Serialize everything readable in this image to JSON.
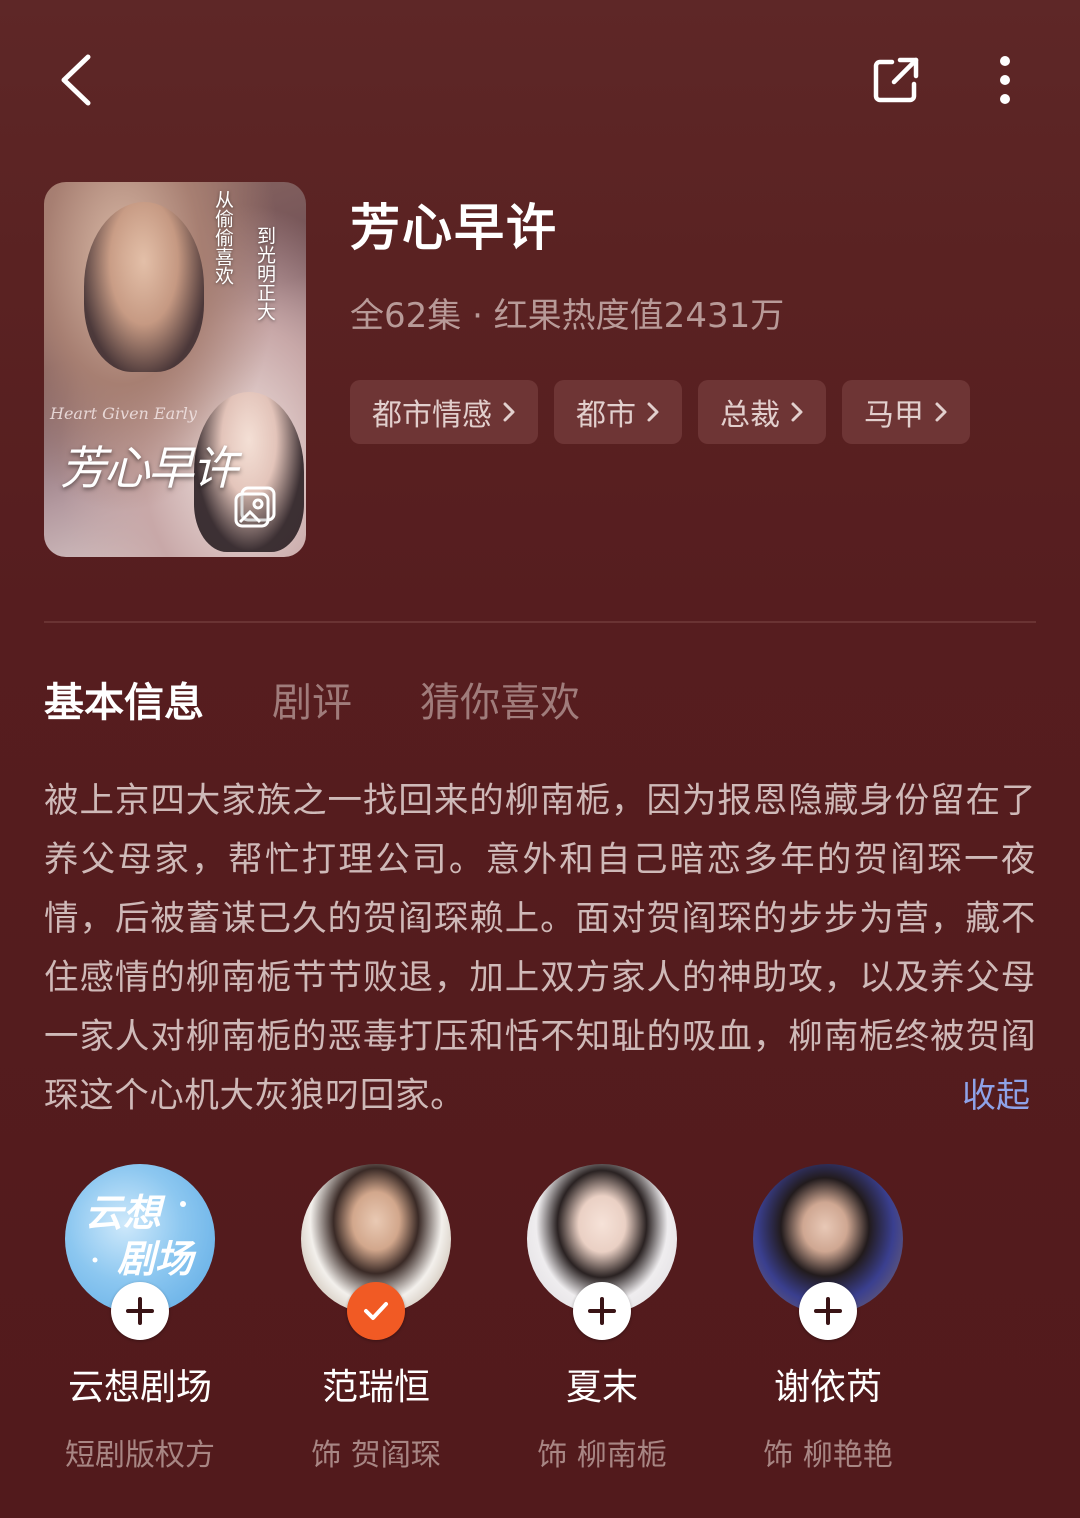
{
  "header": {
    "back_icon": "chevron-left-icon",
    "share_icon": "share-external-icon",
    "more_icon": "more-vertical-icon"
  },
  "poster": {
    "title_art": "芳心早许",
    "en_art": "Heart Given Early",
    "tagline_1": "从偷偷喜欢",
    "tagline_2": "到光明正大"
  },
  "drama": {
    "title": "芳心早许",
    "meta": "全62集 · 红果热度值2431万",
    "tags": [
      {
        "label": "都市情感"
      },
      {
        "label": "都市"
      },
      {
        "label": "总裁"
      },
      {
        "label": "马甲"
      }
    ]
  },
  "tabs": [
    {
      "label": "基本信息",
      "active": true
    },
    {
      "label": "剧评",
      "active": false
    },
    {
      "label": "猜你喜欢",
      "active": false
    }
  ],
  "synopsis": {
    "text": "被上京四大家族之一找回来的柳南栀，因为报恩隐藏身份留在了养父母家，帮忙打理公司。意外和自己暗恋多年的贺阎琛一夜情，后被蓄谋已久的贺阎琛赖上。面对贺阎琛的步步为营，藏不住感情的柳南栀节节败退，加上双方家人的神助攻，以及养父母一家人对柳南栀的恶毒打压和恬不知耻的吸血，柳南栀终被贺阎琛这个心机大灰狼叼回家。",
    "collapse_label": "收起"
  },
  "cast": [
    {
      "name": "云想剧场",
      "role": "短剧版权方",
      "followed": false,
      "logo_line1": "云想",
      "logo_line2": "剧场"
    },
    {
      "name": "范瑞恒",
      "role": "饰 贺阎琛",
      "followed": true
    },
    {
      "name": "夏末",
      "role": "饰 柳南栀",
      "followed": false
    },
    {
      "name": "谢依芮",
      "role": "饰 柳艳艳",
      "followed": false
    }
  ],
  "colors": {
    "background": "#561d1f",
    "accent_link": "#8ea2e8",
    "followed_badge": "#f15a24",
    "tag_bg": "#6e3535"
  }
}
